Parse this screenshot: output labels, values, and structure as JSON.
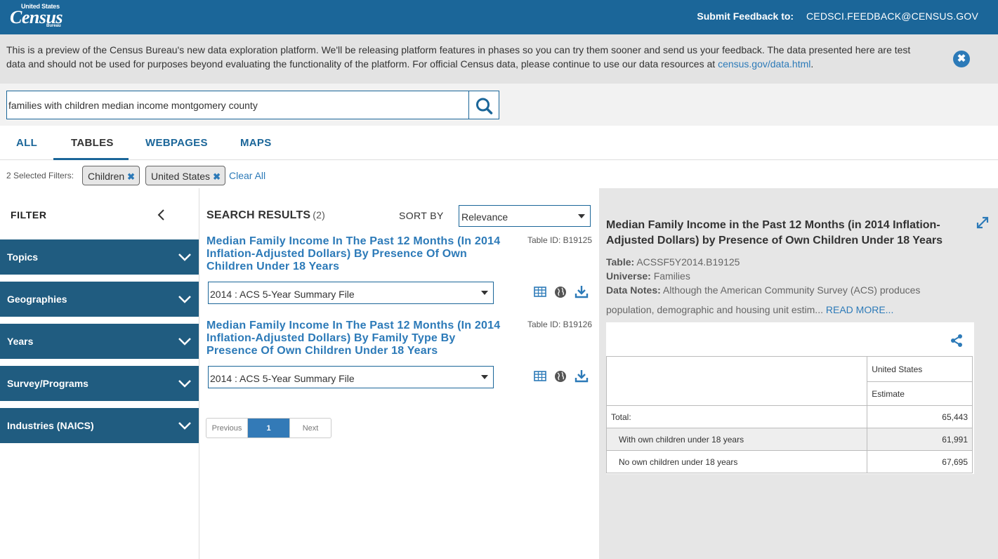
{
  "header": {
    "logo_top": "United States",
    "logo_main": "Census",
    "logo_bottom": "Bureau",
    "feedback_label": "Submit Feedback to:",
    "feedback_email": "CEDSCI.FEEDBACK@CENSUS.GOV"
  },
  "banner": {
    "text": "This is a preview of the Census Bureau's new data exploration platform. We'll be releasing platform features in phases so you can try them sooner and send us your feedback. The data presented here are test data and should not be used for purposes beyond evaluating the functionality of the platform. For official Census data, please continue to use our data resources at ",
    "link": "census.gov/data.html",
    "after_link": "."
  },
  "search": {
    "query": "families with children median income montgomery county"
  },
  "tabs": [
    "ALL",
    "TABLES",
    "WEBPAGES",
    "MAPS"
  ],
  "active_tab": "TABLES",
  "filters": {
    "count_label": "2 Selected Filters:",
    "chips": [
      "Children",
      "United States"
    ],
    "clear_label": "Clear All"
  },
  "sidebar": {
    "title": "FILTER",
    "items": [
      "Topics",
      "Geographies",
      "Years",
      "Survey/Programs",
      "Industries (NAICS)"
    ]
  },
  "results": {
    "heading": "SEARCH RESULTS",
    "count": "(2)",
    "sort_label": "SORT BY",
    "sort_value": "Relevance",
    "items": [
      {
        "title": "Median Family Income In The Past 12 Months (In 2014 Inflation-Adjusted Dollars) By Presence Of Own Children Under 18 Years",
        "table_id": "Table ID: B19125",
        "vintage": "2014 : ACS 5-Year Summary File"
      },
      {
        "title": "Median Family Income In The Past 12 Months (In 2014 Inflation-Adjusted Dollars) By Family Type By Presence Of Own Children Under 18 Years",
        "table_id": "Table ID: B19126",
        "vintage": "2014 : ACS 5-Year Summary File"
      }
    ],
    "pager": {
      "prev": "Previous",
      "current": "1",
      "next": "Next"
    }
  },
  "detail": {
    "title": "Median Family Income in the Past 12 Months (in 2014 Inflation-Adjusted Dollars) by Presence of Own Children Under 18 Years",
    "table_label": "Table:",
    "table_value": "ACSSF5Y2014.B19125",
    "universe_label": "Universe:",
    "universe_value": "Families",
    "notes_label": "Data Notes:",
    "notes_line1": "Although the American Community Survey (ACS) produces",
    "notes_line2": "population, demographic and housing unit estim...",
    "read_more": "READ MORE...",
    "table": {
      "geo_header": "United States",
      "col_header": "Estimate",
      "rows": [
        {
          "label": "Total:",
          "value": "65,443"
        },
        {
          "label": "With own children under 18 years",
          "value": "61,991"
        },
        {
          "label": "No own children under 18 years",
          "value": "67,695"
        }
      ]
    }
  },
  "colors": {
    "header_bg": "#1b6699",
    "accordion_bg": "#205c80",
    "link": "#2c7ab8"
  }
}
